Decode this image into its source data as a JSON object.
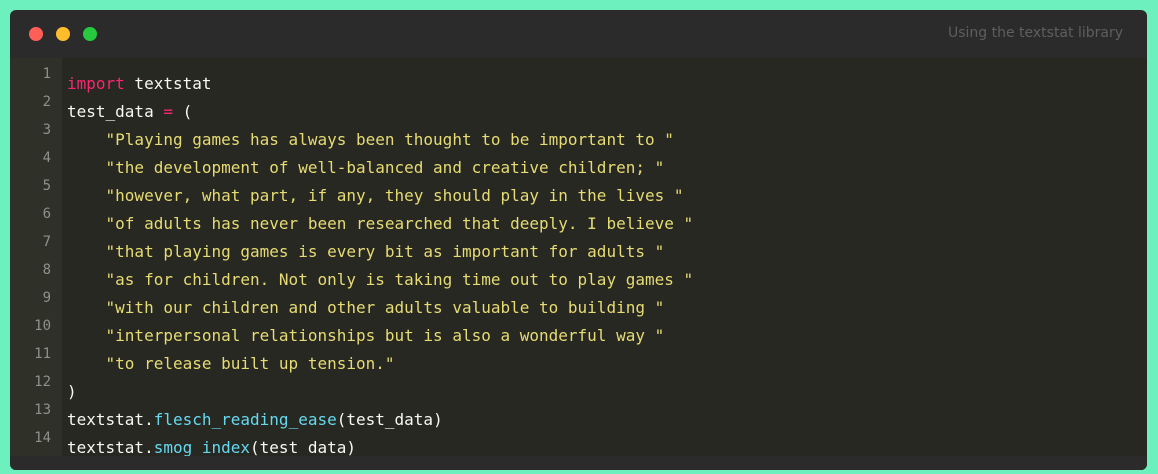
{
  "window": {
    "title": "Using the textstat library"
  },
  "colors": {
    "background": "#6ef0be",
    "window": "#2b2b2b",
    "editor": "#272822",
    "keyword": "#f92672",
    "string": "#e6db74",
    "function": "#66d9ef",
    "plain": "#f8f8f2",
    "line_number": "#8f908a"
  },
  "gutter": {
    "line_numbers": [
      "1",
      "2",
      "3",
      "4",
      "5",
      "6",
      "7",
      "8",
      "9",
      "10",
      "11",
      "12",
      "13",
      "14"
    ]
  },
  "code": {
    "l1": {
      "kw": "import",
      "rest": " textstat"
    },
    "l2": {
      "a": "test_data ",
      "op": "=",
      "b": " ("
    },
    "l3": "    \"Playing games has always been thought to be important to \"",
    "l4": "    \"the development of well-balanced and creative children; \"",
    "l5": "    \"however, what part, if any, they should play in the lives \"",
    "l6": "    \"of adults has never been researched that deeply. I believe \"",
    "l7": "    \"that playing games is every bit as important for adults \"",
    "l8": "    \"as for children. Not only is taking time out to play games \"",
    "l9": "    \"with our children and other adults valuable to building \"",
    "l10": "    \"interpersonal relationships but is also a wonderful way \"",
    "l11": "    \"to release built up tension.\"",
    "l12": ")",
    "l13": {
      "obj": "textstat.",
      "fn": "flesch_reading_ease",
      "args": "(test_data)"
    },
    "l14": {
      "obj": "textstat.",
      "fn": "smog_index",
      "args": "(test_data)"
    }
  }
}
